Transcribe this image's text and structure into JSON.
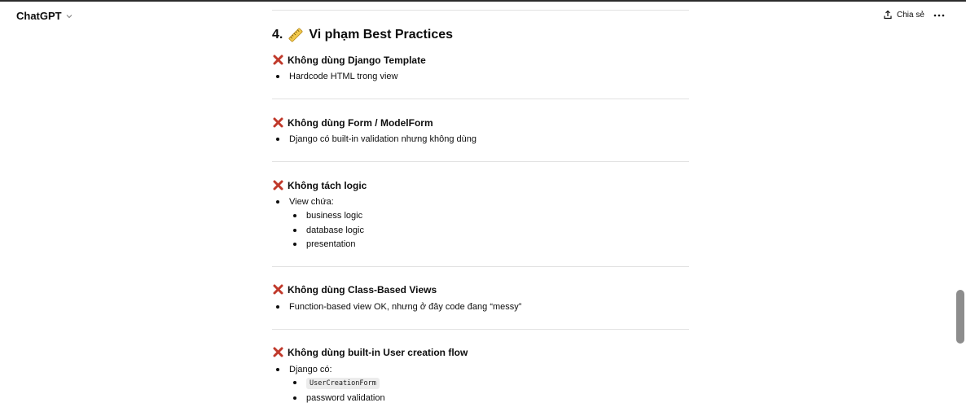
{
  "header": {
    "app_title": "ChatGPT",
    "share_label": "Chia sẻ"
  },
  "section": {
    "number": "4.",
    "title": "Vi phạm Best Practices",
    "icon": "ruler-icon"
  },
  "items": [
    {
      "title": "Không dùng Django Template",
      "bullets": [
        "Hardcode HTML trong view"
      ]
    },
    {
      "title": "Không dùng Form / ModelForm",
      "bullets": [
        "Django có built-in validation nhưng không dùng"
      ]
    },
    {
      "title": "Không tách logic",
      "bullets": [
        "View chứa:"
      ],
      "sub_bullets": [
        "business logic",
        "database logic",
        "presentation"
      ]
    },
    {
      "title": "Không dùng Class-Based Views",
      "bullets": [
        "Function-based view OK, nhưng ở đây code đang “messy”"
      ]
    },
    {
      "title": "Không dùng built-in User creation flow",
      "bullets": [
        "Django có:"
      ],
      "sub_bullets": [
        "UserCreationForm",
        "password validation"
      ]
    }
  ],
  "colors": {
    "cross_mark": "#c0392b",
    "divider": "#e2e2e2",
    "text": "#0d0d0d",
    "scrollbar": "#8d8d8d"
  }
}
